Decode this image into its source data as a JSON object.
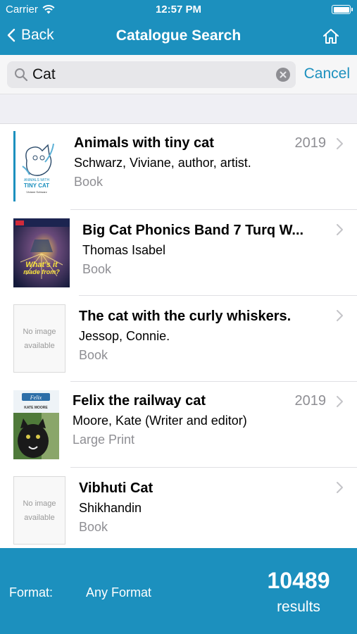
{
  "status": {
    "carrier": "Carrier",
    "time": "12:57 PM"
  },
  "nav": {
    "back_label": "Back",
    "title": "Catalogue Search"
  },
  "search": {
    "value": "Cat",
    "cancel_label": "Cancel"
  },
  "results": [
    {
      "title": "Animals with tiny cat",
      "author": "Schwarz, Viviane, author, artist.",
      "format": "Book",
      "year": "2019",
      "cover": "animals-with-tiny-cat-cover",
      "cover_text": [
        "ANIMALS WITH",
        "TINY CAT",
        "Viviane Schwarz"
      ]
    },
    {
      "title": "Big Cat Phonics Band 7 Turq W...",
      "author": "Thomas Isabel",
      "format": "Book",
      "year": "",
      "cover": "whats-it-made-from-cover",
      "cover_text": [
        "What's it",
        "made from?"
      ]
    },
    {
      "title": "The cat with the curly whiskers.",
      "author": "Jessop, Connie.",
      "format": "Book",
      "year": "",
      "cover": "no-image",
      "cover_text": [
        "No image",
        "available"
      ]
    },
    {
      "title": "Felix the railway cat",
      "author": "Moore, Kate (Writer and editor)",
      "format": "Large Print",
      "year": "2019",
      "cover": "felix-cover",
      "cover_text": [
        "Felix",
        "KATE MOORE"
      ]
    },
    {
      "title": "Vibhuti Cat",
      "author": "Shikhandin",
      "format": "Book",
      "year": "",
      "cover": "no-image",
      "cover_text": [
        "No image",
        "available"
      ]
    }
  ],
  "footer": {
    "format_label": "Format:",
    "format_value": "Any Format",
    "count": "10489",
    "results_label": "results"
  },
  "colors": {
    "brand": "#1c90be",
    "muted": "#8e8e93"
  }
}
